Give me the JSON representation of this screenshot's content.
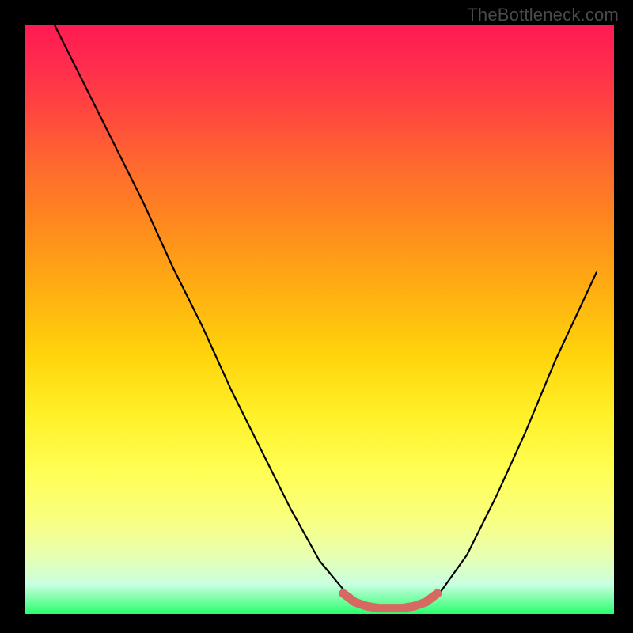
{
  "watermark": "TheBottleneck.com",
  "chart_data": {
    "type": "line",
    "title": "",
    "xlabel": "",
    "ylabel": "",
    "xlim": [
      0,
      1
    ],
    "ylim": [
      0,
      1
    ],
    "series": [
      {
        "name": "curve",
        "x": [
          0.05,
          0.1,
          0.15,
          0.2,
          0.25,
          0.3,
          0.35,
          0.4,
          0.45,
          0.5,
          0.55,
          0.6,
          0.63,
          0.66,
          0.7,
          0.75,
          0.8,
          0.85,
          0.9,
          0.97
        ],
        "y": [
          1.0,
          0.9,
          0.8,
          0.7,
          0.59,
          0.49,
          0.38,
          0.28,
          0.18,
          0.09,
          0.03,
          0.01,
          0.01,
          0.01,
          0.03,
          0.1,
          0.2,
          0.31,
          0.43,
          0.58
        ]
      },
      {
        "name": "flat-highlight",
        "x": [
          0.54,
          0.56,
          0.58,
          0.6,
          0.62,
          0.64,
          0.66,
          0.68,
          0.7
        ],
        "y": [
          0.035,
          0.02,
          0.013,
          0.01,
          0.01,
          0.01,
          0.013,
          0.02,
          0.035
        ]
      }
    ],
    "gradient_stops": [
      {
        "pos": 0.0,
        "color": "#ff1a52"
      },
      {
        "pos": 0.5,
        "color": "#ffd40c"
      },
      {
        "pos": 0.8,
        "color": "#ffff55"
      },
      {
        "pos": 1.0,
        "color": "#2aff6c"
      }
    ]
  }
}
